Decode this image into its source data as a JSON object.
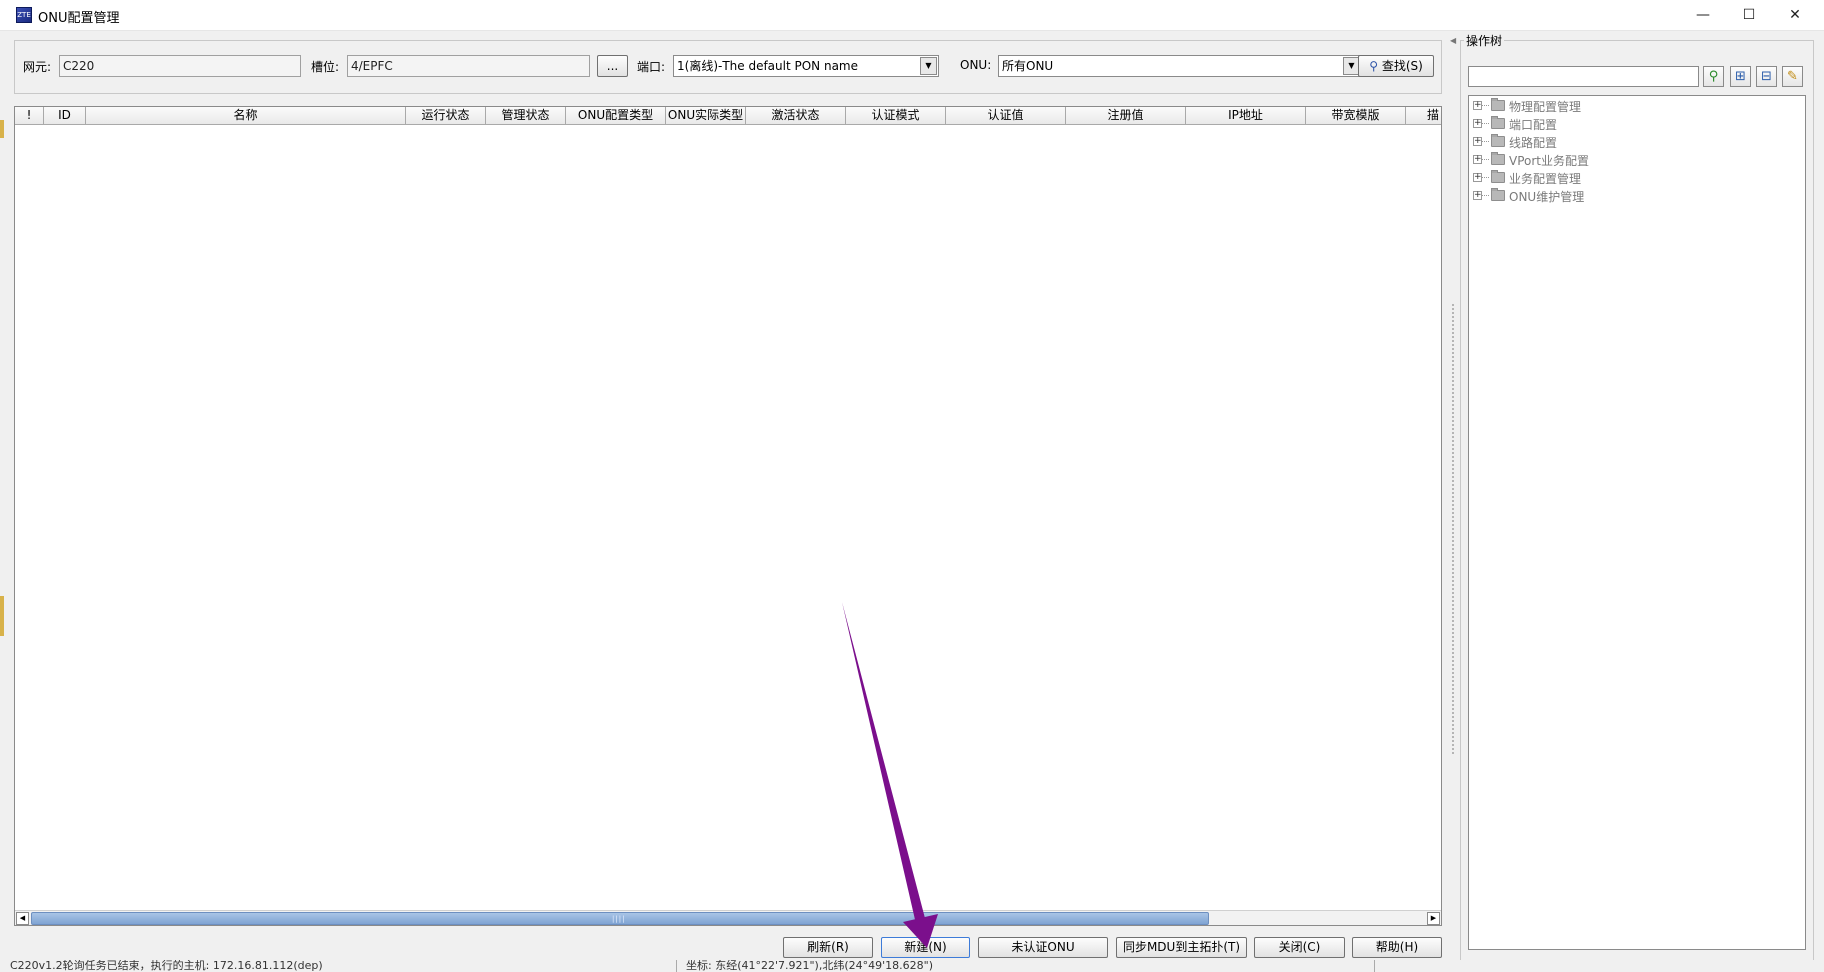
{
  "window": {
    "title": "ONU配置管理",
    "icon_text": "ZTE",
    "min_glyph": "—",
    "max_glyph": "☐",
    "close_glyph": "✕"
  },
  "filter": {
    "ne_label": "网元:",
    "ne_value": "C220",
    "slot_label": "槽位:",
    "slot_value": "4/EPFC",
    "browse_label": "...",
    "port_label": "端口:",
    "port_value": "1(离线)-The default PON name",
    "onu_label": "ONU:",
    "onu_value": "所有ONU",
    "search_label": "查找(S)",
    "combo_arrow": "▼"
  },
  "table": {
    "columns": [
      "!",
      "ID",
      "名称",
      "运行状态",
      "管理状态",
      "ONU配置类型",
      "ONU实际类型",
      "激活状态",
      "认证模式",
      "认证值",
      "注册值",
      "IP地址",
      "带宽模版",
      "描"
    ],
    "scroll_left": "◀",
    "scroll_right": "▶",
    "scroll_grip": "||||"
  },
  "buttons": {
    "refresh": "刷新(R)",
    "new": "新建(N)",
    "unauth_onu": "未认证ONU",
    "sync_mdu": "同步MDU到主拓扑(T)",
    "close": "关闭(C)",
    "help": "帮助(H)"
  },
  "tree": {
    "legend": "操作树",
    "expand_glyph": "+",
    "items": [
      {
        "label": "物理配置管理"
      },
      {
        "label": "端口配置"
      },
      {
        "label": "线路配置"
      },
      {
        "label": "VPort业务配置"
      },
      {
        "label": "业务配置管理"
      },
      {
        "label": "ONU维护管理"
      }
    ],
    "tool_find_glyph": "⚲",
    "tool_expand_glyph": "⊞",
    "tool_collapse_glyph": "⊟",
    "tool_settings_glyph": "✎"
  },
  "status": {
    "left": "C220v1.2轮询任务已结束，执行的主机: 172.16.81.112(dep)",
    "right": "坐标: 东经(41°22'7.921\"),北纬(24°49'18.628\")"
  },
  "colors": {
    "annotation_arrow": "#7b0f8c",
    "scroll_thumb": "#8fb0dc"
  }
}
